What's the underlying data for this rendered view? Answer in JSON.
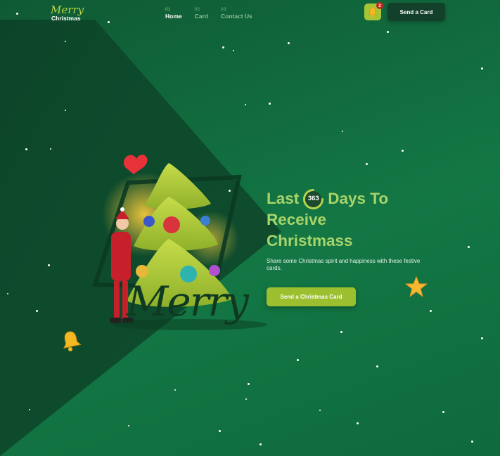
{
  "logo": {
    "script": "Merry",
    "word": "Christmas"
  },
  "nav": {
    "items": [
      {
        "num": "01",
        "label": "Home",
        "active": true
      },
      {
        "num": "02",
        "label": "Card",
        "active": false
      },
      {
        "num": "03",
        "label": "Contact Us",
        "active": false
      }
    ]
  },
  "header": {
    "notification_count": "2",
    "bell_icon": "bell-icon",
    "send_card_label": "Send a Card"
  },
  "hero": {
    "title_prefix": "Last",
    "countdown_value": "363",
    "title_after_counter": "Days To",
    "title_line2": "Receive",
    "title_line3": "Christmass",
    "description": "Share some Christmas spirit and happiness with these festive cards.",
    "cta_label": "Send a Christmas Card",
    "illustration_text": "Merry"
  },
  "colors": {
    "background": "#137744",
    "accent": "#a6c436",
    "title": "#a9d46a",
    "button_dark": "#13402a",
    "badge": "#c2271e"
  }
}
